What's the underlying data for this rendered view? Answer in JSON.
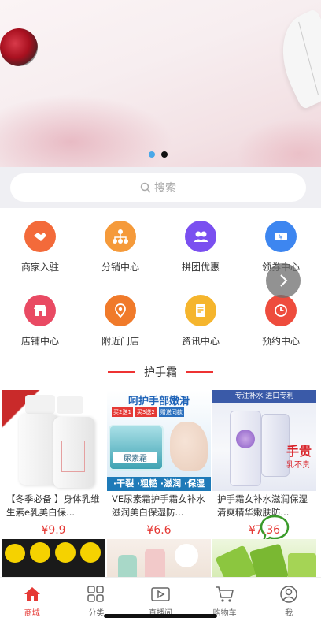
{
  "banner": {
    "active_dot": 1,
    "dot_colors": [
      "#4aa8e8",
      "#111111"
    ]
  },
  "search": {
    "placeholder": "搜索"
  },
  "grid": {
    "items": [
      {
        "label": "商家入驻",
        "icon": "handshake-icon",
        "color": "#f36a3a"
      },
      {
        "label": "分销中心",
        "icon": "network-icon",
        "color": "#f59a3a"
      },
      {
        "label": "拼团优惠",
        "icon": "group-icon",
        "color": "#7a4ff0"
      },
      {
        "label": "领券中心",
        "icon": "coupon-icon",
        "color": "#3d86f0"
      },
      {
        "label": "店铺中心",
        "icon": "shop-icon",
        "color": "#e94a63"
      },
      {
        "label": "附近门店",
        "icon": "location-icon",
        "color": "#f07a2a"
      },
      {
        "label": "资讯中心",
        "icon": "news-icon",
        "color": "#f5b52d"
      },
      {
        "label": "预约中心",
        "icon": "clock-icon",
        "color": "#ee4c3d"
      }
    ]
  },
  "section": {
    "title": "护手霜"
  },
  "products": [
    {
      "name": "【冬季必备 】身体乳维生素e乳美白保...",
      "price": "¥9.9"
    },
    {
      "name": "VE尿素霜护手霜女补水滋润美白保湿防...",
      "price": "¥6.6",
      "img_text": {
        "top": "呵护手部嫩滑",
        "tag1": "买2送1",
        "tag2": "买3送2",
        "tag3": "赠送同款",
        "jar": "尿素霜",
        "bottom": "·干裂 ·粗糙 ·滋润 ·保湿"
      }
    },
    {
      "name": "护手霜女补水滋润保湿清爽精华嫩肤防...",
      "price": "¥7.36",
      "img_text": {
        "top": "专注补水 进口专利",
        "bottom": "手贵",
        "bottom2": "乳不贵"
      }
    }
  ],
  "tabbar": {
    "active": 0,
    "tabs": [
      {
        "label": "商城",
        "icon": "home-icon"
      },
      {
        "label": "分类",
        "icon": "category-icon"
      },
      {
        "label": "直播间",
        "icon": "live-icon"
      },
      {
        "label": "购物车",
        "icon": "cart-icon"
      },
      {
        "label": "我",
        "icon": "user-icon"
      }
    ]
  },
  "colors": {
    "accent": "#e53935",
    "chat": "#3a9a2a"
  }
}
